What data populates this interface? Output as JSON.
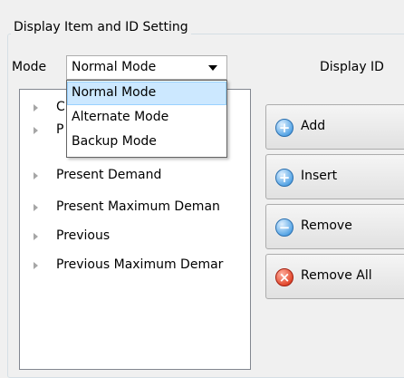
{
  "group": {
    "title": "Display Item and ID Setting"
  },
  "mode": {
    "label": "Mode",
    "selected": "Normal Mode",
    "options": [
      "Normal Mode",
      "Alternate Mode",
      "Backup Mode"
    ]
  },
  "display_id": {
    "label": "Display ID"
  },
  "tree": {
    "items": [
      {
        "label": "C"
      },
      {
        "label": "P"
      },
      {
        "label": "Present Demand"
      },
      {
        "label": "Present Maximum Deman"
      },
      {
        "label": "Previous"
      },
      {
        "label": "Previous Maximum Demar"
      }
    ]
  },
  "buttons": {
    "add": {
      "label": "Add",
      "icon": "plus-circle-icon"
    },
    "insert": {
      "label": "Insert",
      "icon": "plus-circle-icon"
    },
    "remove": {
      "label": "Remove",
      "icon": "minus-circle-icon"
    },
    "remove_all": {
      "label": "Remove All",
      "icon": "x-circle-icon"
    }
  },
  "colors": {
    "highlight": "#cce8ff",
    "blue_icon": "#5aa7e6",
    "red_icon": "#e24a2f"
  }
}
